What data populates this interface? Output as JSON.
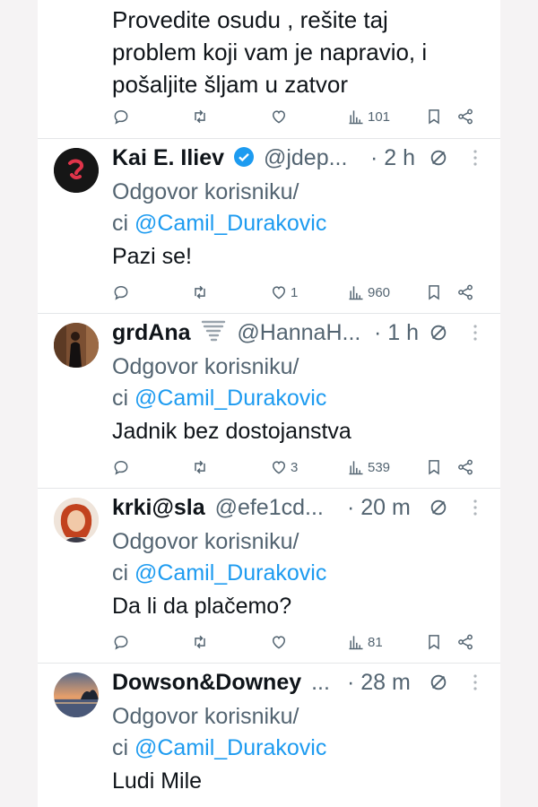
{
  "top_tweet": {
    "lines": [
      "Provedite osudu , rešite taj",
      "problem koji vam je napravio, i",
      "pošaljite šljam u zatvor"
    ],
    "views": "101",
    "likes": "",
    "replies": "",
    "retweets": ""
  },
  "tweets": [
    {
      "name": "Kai E. Iliev",
      "verified": true,
      "handle": "@jdep...",
      "time": "· 2 h",
      "reply_prefix": "Odgovor korisniku/",
      "reply_ci": "ci ",
      "mention": "@Camil_Durakovic",
      "text": "Pazi se!",
      "likes": "1",
      "views": "960",
      "avatar_icon": "red-swirl-logo-icon"
    },
    {
      "name": "grdAna",
      "emoji_icon": "tornado-icon",
      "handle": "@HannaH...",
      "time": "· 1 h",
      "reply_prefix": "Odgovor korisniku/",
      "reply_ci": "ci ",
      "mention": "@Camil_Durakovic",
      "text": "Jadnik bez dostojanstva",
      "likes": "3",
      "views": "539",
      "avatar_icon": "person-photo-icon"
    },
    {
      "name": "krki@sla",
      "handle": "@efe1cd...",
      "time": "· 20 m",
      "reply_prefix": "Odgovor korisniku/",
      "reply_ci": "ci ",
      "mention": "@Camil_Durakovic",
      "text": "Da li da plačemo?",
      "likes": "",
      "views": "81",
      "avatar_icon": "woman-portrait-icon"
    },
    {
      "name": "Dowson&Downey",
      "handle": "...",
      "time": "· 28 m",
      "reply_prefix": "Odgovor korisniku/",
      "reply_ci": "ci ",
      "mention": "@Camil_Durakovic",
      "text": "Ludi Mile",
      "avatar_icon": "sunset-landscape-icon"
    }
  ],
  "colors": {
    "link": "#1d9bf0",
    "secondary": "#536471",
    "verified": "#1d9bf0"
  }
}
